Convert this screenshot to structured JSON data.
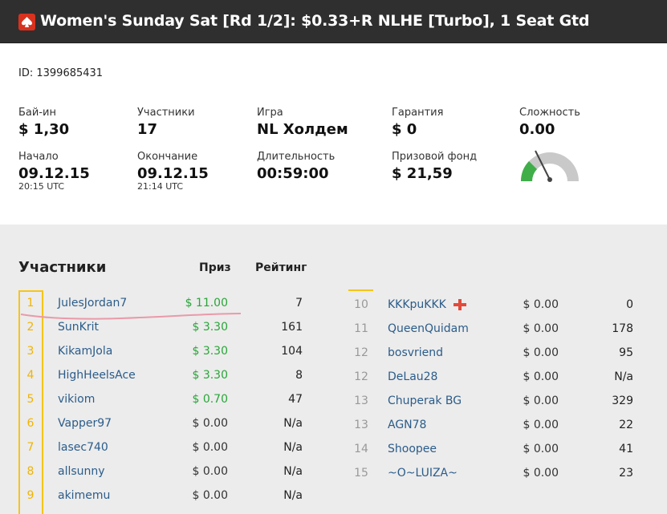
{
  "header": {
    "title": "Women's Sunday Sat [Rd 1/2]: $0.33+R NLHE [Turbo], 1 Seat Gtd"
  },
  "id_line": "ID: 1399685431",
  "stats": {
    "buyin": {
      "label": "Бай-ин",
      "value": "$ 1,30"
    },
    "entrants": {
      "label": "Участники",
      "value": "17"
    },
    "game": {
      "label": "Игра",
      "value": "NL Холдем"
    },
    "guarantee": {
      "label": "Гарантия",
      "value": "$ 0"
    },
    "difficulty": {
      "label": "Сложность",
      "value": "0.00",
      "level": 0.0
    },
    "start": {
      "label": "Начало",
      "value": "09.12.15",
      "time": "20:15 UTC"
    },
    "end": {
      "label": "Окончание",
      "value": "09.12.15",
      "time": "21:14 UTC"
    },
    "duration": {
      "label": "Длительность",
      "value": "00:59:00"
    },
    "prizepool": {
      "label": "Призовой фонд",
      "value": "$ 21,59"
    }
  },
  "results": {
    "title": "Участники",
    "col_prize": "Приз",
    "col_rating": "Рейтинг",
    "left": [
      {
        "rank": "1",
        "name": "JulesJordan7",
        "prize": "$ 11.00",
        "rating": "7",
        "win": true
      },
      {
        "rank": "2",
        "name": "SunKrit",
        "prize": "$ 3.30",
        "rating": "161",
        "win": true
      },
      {
        "rank": "3",
        "name": "KikamJola",
        "prize": "$ 3.30",
        "rating": "104",
        "win": true
      },
      {
        "rank": "4",
        "name": "HighHeelsAce",
        "prize": "$ 3.30",
        "rating": "8",
        "win": true
      },
      {
        "rank": "5",
        "name": "vikiom",
        "prize": "$ 0.70",
        "rating": "47",
        "win": true
      },
      {
        "rank": "6",
        "name": "Vapper97",
        "prize": "$ 0.00",
        "rating": "N/a",
        "win": false
      },
      {
        "rank": "7",
        "name": "lasec740",
        "prize": "$ 0.00",
        "rating": "N/a",
        "win": false
      },
      {
        "rank": "8",
        "name": "allsunny",
        "prize": "$ 0.00",
        "rating": "N/a",
        "win": false
      },
      {
        "rank": "9",
        "name": "akimemu",
        "prize": "$ 0.00",
        "rating": "N/a",
        "win": false
      }
    ],
    "right": [
      {
        "rank": "10",
        "name": "KKKpuKKK",
        "prize": "$ 0.00",
        "rating": "0",
        "flag": true
      },
      {
        "rank": "11",
        "name": "QueenQuidam",
        "prize": "$ 0.00",
        "rating": "178"
      },
      {
        "rank": "12",
        "name": "bosvriend",
        "prize": "$ 0.00",
        "rating": "95"
      },
      {
        "rank": "12",
        "name": "DeLau28",
        "prize": "$ 0.00",
        "rating": "N/a"
      },
      {
        "rank": "13",
        "name": "Chuperak BG",
        "prize": "$ 0.00",
        "rating": "329"
      },
      {
        "rank": "13",
        "name": "AGN78",
        "prize": "$ 0.00",
        "rating": "22"
      },
      {
        "rank": "14",
        "name": "Shoopee",
        "prize": "$ 0.00",
        "rating": "41"
      },
      {
        "rank": "15",
        "name": "~O~LUIZA~",
        "prize": "$ 0.00",
        "rating": "23"
      }
    ]
  },
  "colors": {
    "header_bg": "#2f2f2f",
    "logo": "#d8321f",
    "accent_yellow": "#f5c518",
    "win_green": "#2aa53a",
    "link_blue": "#2b5c8a",
    "underline_pink": "#e99aa9"
  },
  "icons": {
    "logo": "pokerstars-spade-icon",
    "gauge": "difficulty-gauge-icon",
    "flag": "red-cross-flag-icon"
  }
}
